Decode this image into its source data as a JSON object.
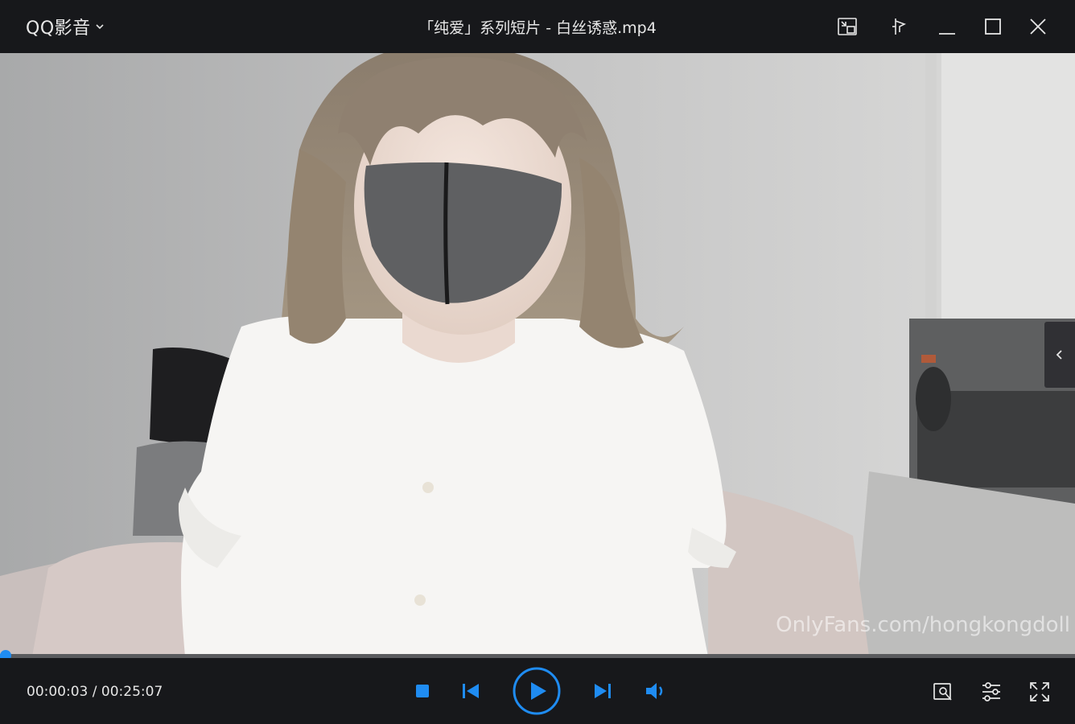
{
  "app": {
    "name": "QQ影音",
    "file_title": "「纯爱」系列短片 - 白丝诱惑.mp4"
  },
  "window_controls": [
    {
      "name": "mini-mode-icon"
    },
    {
      "name": "pin-top-icon"
    },
    {
      "name": "minimize-icon"
    },
    {
      "name": "maximize-icon"
    },
    {
      "name": "close-icon"
    }
  ],
  "video": {
    "watermark": "OnlyFans.com/hongkongdoll"
  },
  "playback": {
    "current_time": "00:00:03",
    "separator": " / ",
    "total_time": "00:25:07",
    "progress": 0.002
  },
  "controls": {
    "stop": "stop-icon",
    "previous": "previous-icon",
    "play": "play-icon",
    "next": "next-icon",
    "volume": "volume-icon",
    "screenshot": "screenshot-tool-icon",
    "settings": "settings-sliders-icon",
    "fullscreen": "fullscreen-icon"
  },
  "colors": {
    "accent": "#1f8cf2",
    "bar_background": "#17181b"
  }
}
